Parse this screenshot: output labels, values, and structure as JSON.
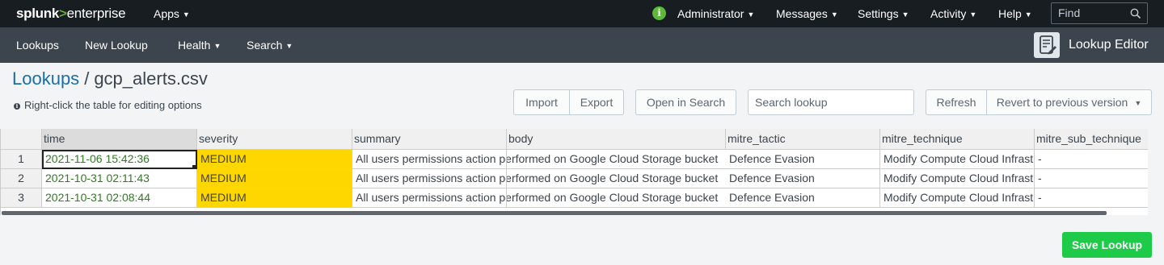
{
  "topbar": {
    "logo_part1": "splunk",
    "logo_part2": ">",
    "logo_part3": "enterprise",
    "apps_label": "Apps",
    "user_label": "Administrator",
    "messages_label": "Messages",
    "settings_label": "Settings",
    "activity_label": "Activity",
    "help_label": "Help",
    "find_placeholder": "Find",
    "info_glyph": "i"
  },
  "appbar": {
    "items": [
      "Lookups",
      "New Lookup",
      "Health",
      "Search"
    ],
    "app_title": "Lookup Editor",
    "app_icon": "lookup-editor-icon"
  },
  "header": {
    "breadcrumb_link": "Lookups",
    "breadcrumb_sep": "/",
    "file_name": "gcp_alerts.csv",
    "hint": "Right-click the table for editing options"
  },
  "toolbar": {
    "import_label": "Import",
    "export_label": "Export",
    "open_in_search_label": "Open in Search",
    "search_placeholder": "Search lookup",
    "refresh_label": "Refresh",
    "revert_label": "Revert to previous version"
  },
  "table": {
    "columns": [
      "time",
      "severity",
      "summary",
      "body",
      "mitre_tactic",
      "mitre_technique",
      "mitre_sub_technique"
    ],
    "rows": [
      {
        "num": "1",
        "time": "2021-11-06 15:42:36",
        "severity": "MEDIUM",
        "summary": "All users permissions action performed on Google Cloud Storage bucket",
        "mitre_tactic": "Defence Evasion",
        "mitre_technique": "Modify Compute Cloud Infrastructure",
        "mitre_sub_technique": "-"
      },
      {
        "num": "2",
        "time": "2021-10-31 02:11:43",
        "severity": "MEDIUM",
        "summary": "All users permissions action performed on Google Cloud Storage bucket",
        "mitre_tactic": "Defence Evasion",
        "mitre_technique": "Modify Compute Cloud Infrastructure",
        "mitre_sub_technique": "-"
      },
      {
        "num": "3",
        "time": "2021-10-31 02:08:44",
        "severity": "MEDIUM",
        "summary": "All users permissions action performed on Google Cloud Storage bucket",
        "mitre_tactic": "Defence Evasion",
        "mitre_technique": "Modify Compute Cloud Infrastructure",
        "mitre_sub_technique": "-"
      }
    ]
  },
  "footer": {
    "save_label": "Save Lookup"
  },
  "colors": {
    "topbar_bg": "#171d21",
    "appbar_bg": "#3c444d",
    "accent_green": "#65a637",
    "save_green": "#1ecb48",
    "severity_medium": "#ffd700",
    "link_blue": "#1a6fa8"
  }
}
